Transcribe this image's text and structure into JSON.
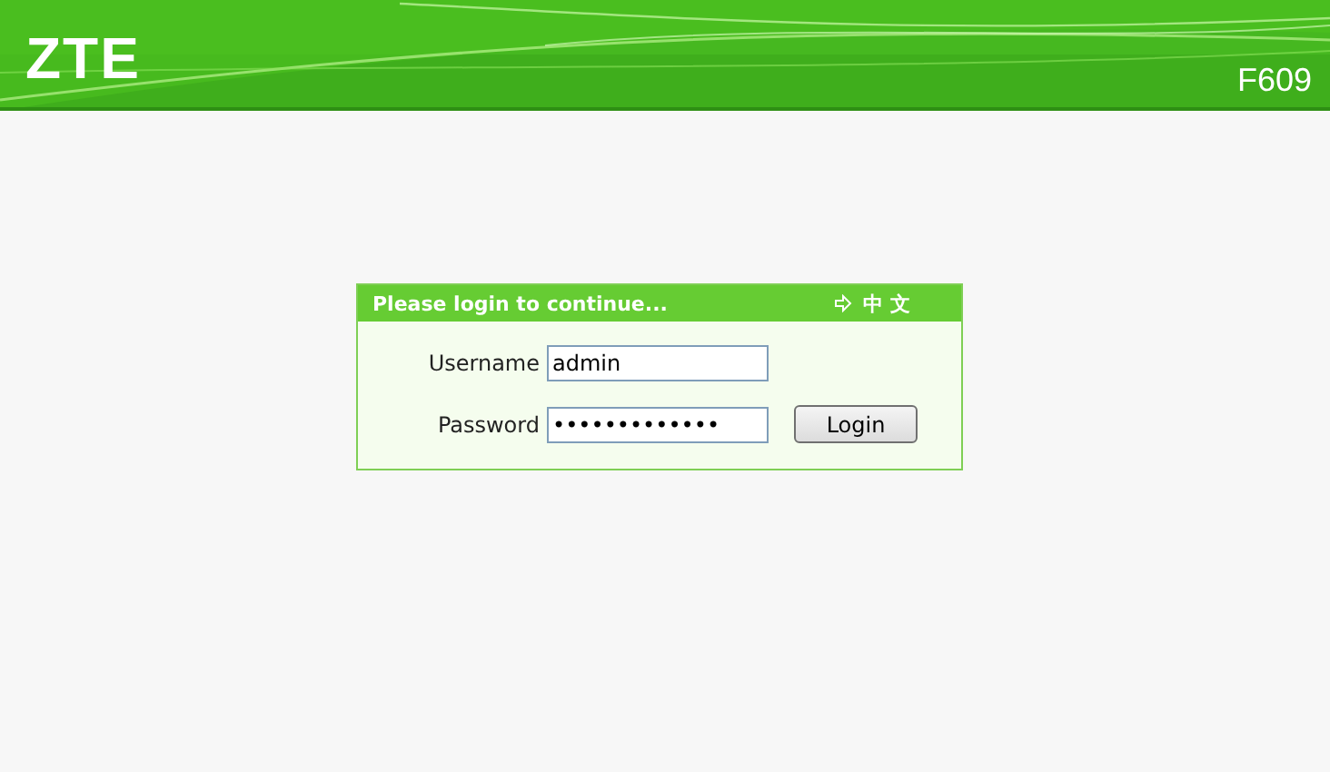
{
  "header": {
    "logo": "ZTE",
    "model": "F609"
  },
  "login": {
    "title": "Please login to continue...",
    "language_link": "中 文",
    "fields": [
      {
        "label": "Username",
        "value": "admin"
      },
      {
        "label": "Password",
        "value": "•••••••••••••"
      }
    ],
    "button": "Login"
  }
}
